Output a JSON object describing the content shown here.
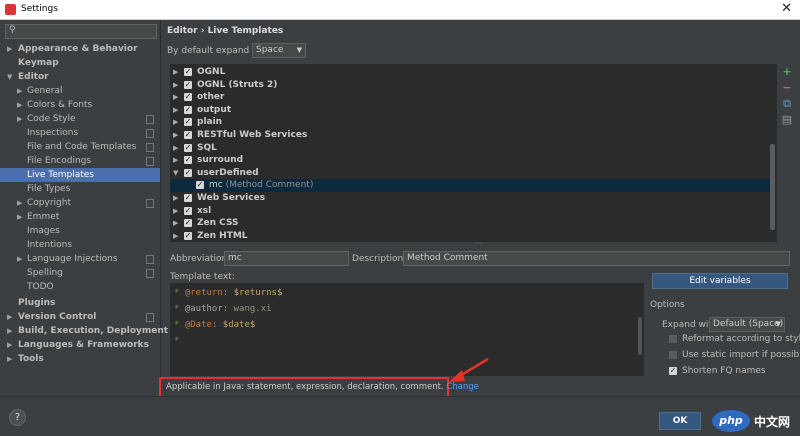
{
  "window": {
    "title": "Settings"
  },
  "sidebar": {
    "search_placeholder": "",
    "items": [
      {
        "label": "Appearance & Behavior",
        "arrow": "▶"
      },
      {
        "label": "Keymap",
        "arrow": ""
      },
      {
        "label": "Editor",
        "arrow": "▼"
      },
      {
        "label": "General",
        "arrow": "▶"
      },
      {
        "label": "Colors & Fonts",
        "arrow": "▶"
      },
      {
        "label": "Code Style",
        "arrow": "▶"
      },
      {
        "label": "Inspections",
        "arrow": ""
      },
      {
        "label": "File and Code Templates",
        "arrow": ""
      },
      {
        "label": "File Encodings",
        "arrow": ""
      },
      {
        "label": "Live Templates",
        "arrow": ""
      },
      {
        "label": "File Types",
        "arrow": ""
      },
      {
        "label": "Copyright",
        "arrow": "▶"
      },
      {
        "label": "Emmet",
        "arrow": "▶"
      },
      {
        "label": "Images",
        "arrow": ""
      },
      {
        "label": "Intentions",
        "arrow": ""
      },
      {
        "label": "Language Injections",
        "arrow": "▶"
      },
      {
        "label": "Spelling",
        "arrow": ""
      },
      {
        "label": "TODO",
        "arrow": ""
      },
      {
        "label": "Plugins",
        "arrow": ""
      },
      {
        "label": "Version Control",
        "arrow": "▶"
      },
      {
        "label": "Build, Execution, Deployment",
        "arrow": "▶"
      },
      {
        "label": "Languages & Frameworks",
        "arrow": "▶"
      },
      {
        "label": "Tools",
        "arrow": "▶"
      }
    ]
  },
  "main": {
    "breadcrumb": "Editor › Live Templates",
    "expand_label": "By default expand with",
    "expand_value": "Space",
    "templates": [
      {
        "label": "OGNL",
        "arrow": "▶",
        "checked": "✓"
      },
      {
        "label": "OGNL (Struts 2)",
        "arrow": "▶",
        "checked": "✓"
      },
      {
        "label": "other",
        "arrow": "▶",
        "checked": "✓"
      },
      {
        "label": "output",
        "arrow": "▶",
        "checked": "✓"
      },
      {
        "label": "plain",
        "arrow": "▶",
        "checked": "✓"
      },
      {
        "label": "RESTful Web Services",
        "arrow": "▶",
        "checked": "✓"
      },
      {
        "label": "SQL",
        "arrow": "▶",
        "checked": "✓"
      },
      {
        "label": "surround",
        "arrow": "▶",
        "checked": "✓"
      },
      {
        "label": "userDefined",
        "arrow": "▼",
        "checked": "✓"
      },
      {
        "label": "mc",
        "desc": "(Method Comment)",
        "arrow": "",
        "checked": "✓"
      },
      {
        "label": "Web Services",
        "arrow": "▶",
        "checked": "✓"
      },
      {
        "label": "xsl",
        "arrow": "▶",
        "checked": "✓"
      },
      {
        "label": "Zen CSS",
        "arrow": "▶",
        "checked": "✓"
      },
      {
        "label": "Zen HTML",
        "arrow": "▶",
        "checked": "✓"
      }
    ],
    "tools": {
      "add": "+",
      "remove": "−",
      "copy": "⧉",
      "group": "▤"
    },
    "abbreviation_label": "Abbreviation:",
    "abbreviation_value": "mc",
    "description_label": "Description:",
    "description_value": "Method Comment",
    "template_text_label": "Template text:",
    "code": {
      "line1": {
        "star": "* ",
        "tag": "@return",
        "sep": ": ",
        "var": "$returns$"
      },
      "line2": {
        "star": "* ",
        "tag": "@author",
        "sep": ": ",
        "text": "wang.xi"
      },
      "line3": {
        "star": "* ",
        "tag": "@Date",
        "sep": ": ",
        "var": "$date$"
      },
      "line4": {
        "star": "*"
      }
    },
    "edit_variables": "Edit variables",
    "options": {
      "title": "Options",
      "expand_with_label": "Expand with",
      "expand_with_value": "Default (Space)",
      "reformat": "Reformat according to style",
      "static_import": "Use static import if possible",
      "shorten_fq": "Shorten FQ names",
      "check": "✓"
    },
    "applicable_text": "Applicable in Java: statement, expression, declaration, comment.",
    "applicable_link": "Change"
  },
  "footer": {
    "help": "?",
    "ok": "OK"
  },
  "watermark": {
    "logo": "php",
    "text": "中文网"
  },
  "colors": {
    "selection": "#4b6eaf",
    "highlight_border": "#e5332a",
    "link": "#589df6"
  }
}
